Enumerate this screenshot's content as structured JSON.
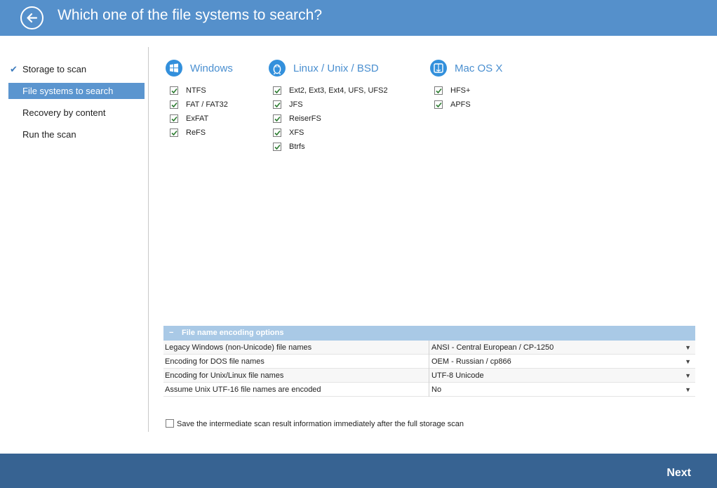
{
  "header": {
    "title": "Which one of the file systems to search?"
  },
  "sidebar": {
    "items": [
      {
        "label": "Storage to scan",
        "state": "done"
      },
      {
        "label": "File systems to search",
        "state": "active"
      },
      {
        "label": "Recovery by content",
        "state": "pending"
      },
      {
        "label": "Run the scan",
        "state": "pending"
      }
    ]
  },
  "groups": {
    "windows": {
      "name": "Windows",
      "icon": "windows-logo-icon",
      "items": [
        {
          "label": "NTFS",
          "checked": true
        },
        {
          "label": "FAT / FAT32",
          "checked": true
        },
        {
          "label": "ExFAT",
          "checked": true
        },
        {
          "label": "ReFS",
          "checked": true
        }
      ]
    },
    "linux": {
      "name": "Linux / Unix / BSD",
      "icon": "linux-penguin-icon",
      "items": [
        {
          "label": "Ext2, Ext3, Ext4, UFS, UFS2",
          "checked": true
        },
        {
          "label": "JFS",
          "checked": true
        },
        {
          "label": "ReiserFS",
          "checked": true
        },
        {
          "label": "XFS",
          "checked": true
        },
        {
          "label": "Btrfs",
          "checked": true
        }
      ]
    },
    "mac": {
      "name": "Mac OS X",
      "icon": "mac-finder-icon",
      "items": [
        {
          "label": "HFS+",
          "checked": true
        },
        {
          "label": "APFS",
          "checked": true
        }
      ]
    }
  },
  "encoding": {
    "title": "File name encoding options",
    "toggle": "−",
    "rows": [
      {
        "label": "Legacy Windows (non-Unicode) file names",
        "value": "ANSI - Central European / CP-1250"
      },
      {
        "label": "Encoding for DOS file names",
        "value": "OEM - Russian / cp866"
      },
      {
        "label": "Encoding for Unix/Linux file names",
        "value": "UTF-8 Unicode"
      },
      {
        "label": "Assume Unix UTF-16 file names are encoded",
        "value": "No"
      }
    ]
  },
  "save_option": {
    "label": "Save the intermediate scan result information immediately after the full storage scan",
    "checked": false
  },
  "footer": {
    "next_label": "Next"
  },
  "colors": {
    "header": "#5590cb",
    "footer": "#376392",
    "accent": "#5b95cf",
    "os_title": "#4a8fd0",
    "check": "#3d7bbd"
  }
}
